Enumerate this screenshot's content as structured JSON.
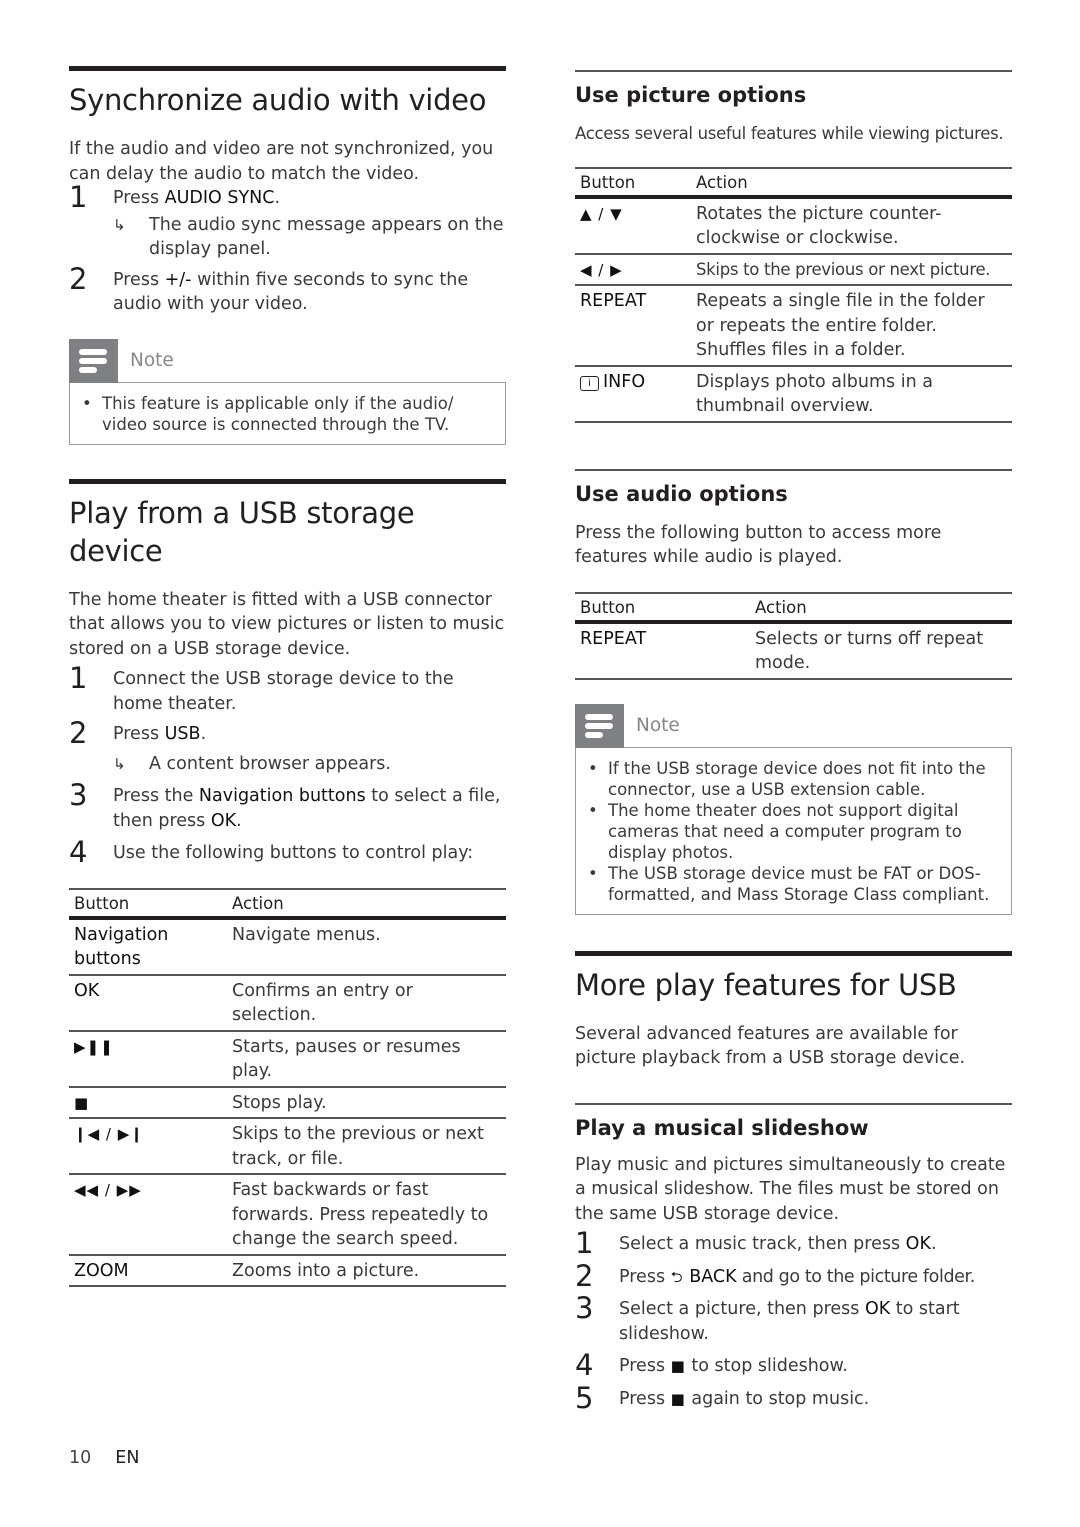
{
  "left": {
    "sync": {
      "title": "Synchronize audio with video",
      "intro": "If the audio and video are not synchronized, you can delay the audio to match the video.",
      "steps": [
        {
          "num": "1",
          "pre": "Press ",
          "kw": "AUDIO SYNC",
          "post": ".",
          "result": "The audio sync message appears on the display panel."
        },
        {
          "num": "2",
          "pre": "Press ",
          "kw": "+/-",
          "post": " within five seconds to sync the audio with your video."
        }
      ],
      "note": {
        "title": "Note",
        "items": [
          "This feature is applicable only if the audio/ video source is connected through the TV."
        ]
      }
    },
    "usb": {
      "title": "Play from a USB storage device",
      "intro": "The home theater is fitted with a USB connector that allows you to view pictures or listen to music stored on a USB storage device.",
      "steps": [
        {
          "num": "1",
          "text": "Connect the USB storage device to the home theater."
        },
        {
          "num": "2",
          "pre": "Press ",
          "kw": "USB",
          "post": ".",
          "result": "A content browser appears."
        },
        {
          "num": "3",
          "pre": "Press the ",
          "kw": "Navigation buttons",
          "mid": " to select a file, then press ",
          "kw2": "OK",
          "post": "."
        },
        {
          "num": "4",
          "text": "Use the following buttons to control play:"
        }
      ],
      "table": {
        "headers": [
          "Button",
          "Action"
        ],
        "rows": [
          {
            "button": "Navigation buttons",
            "icon": "",
            "action": "Navigate menus."
          },
          {
            "button": "OK",
            "icon": "",
            "action": "Confirms an entry or selection."
          },
          {
            "button": "",
            "icon": "▶❚❚",
            "icon_name": "play-pause-icon",
            "action": "Starts, pauses or resumes play."
          },
          {
            "button": "",
            "icon": "■",
            "icon_name": "stop-icon",
            "action": "Stops play."
          },
          {
            "button": "",
            "icon": "❙◀ / ▶❙",
            "icon_name": "skip-prev-next-icon",
            "action": "Skips to the previous or next track, or file."
          },
          {
            "button": "",
            "icon": "◀◀ / ▶▶",
            "icon_name": "rewind-fastforward-icon",
            "action": "Fast backwards or fast forwards. Press repeatedly to change the search speed."
          },
          {
            "button": "ZOOM",
            "icon": "",
            "action": "Zooms into a picture."
          }
        ]
      }
    }
  },
  "right": {
    "picture": {
      "title": "Use picture options",
      "intro": "Access several useful features while viewing pictures.",
      "table": {
        "headers": [
          "Button",
          "Action"
        ],
        "rows": [
          {
            "icon": "▲ / ▼",
            "icon_name": "up-down-arrows-icon",
            "button": "",
            "action": "Rotates the picture counter-clockwise or clockwise."
          },
          {
            "icon": "◀ / ▶",
            "icon_name": "left-right-arrows-icon",
            "button": "",
            "action": "Skips to the previous or next picture."
          },
          {
            "icon": "",
            "button": "REPEAT",
            "action": "Repeats a single file in the folder or repeats the entire folder. Shuffles files in a folder."
          },
          {
            "icon": "i",
            "icon_name": "info-icon",
            "button": "INFO",
            "action": "Displays photo albums in a thumbnail overview."
          }
        ]
      }
    },
    "audio": {
      "title": "Use audio options",
      "intro": "Press the following button to access more features while audio is played.",
      "table": {
        "headers": [
          "Button",
          "Action"
        ],
        "rows": [
          {
            "button": "REPEAT",
            "action": "Selects or turns off repeat mode."
          }
        ]
      },
      "note": {
        "title": "Note",
        "items": [
          "If the USB storage device does not fit into the connector, use a USB extension cable.",
          "The home theater does not support digital cameras that need a computer program to display photos.",
          "The USB storage device must be FAT or DOS-formatted, and Mass Storage Class compliant."
        ]
      }
    },
    "more": {
      "title": "More play features for USB",
      "intro": "Several advanced features are available for picture playback from a USB storage device."
    },
    "slideshow": {
      "title": "Play a musical slideshow",
      "intro": "Play music and pictures simultaneously to create a musical slideshow. The files must be stored on the same USB storage device.",
      "steps": [
        {
          "num": "1",
          "pre": "Select a music track, then press ",
          "kw": "OK",
          "post": "."
        },
        {
          "num": "2",
          "pre": "Press ",
          "icon": "⮌",
          "kw": "BACK",
          "post": " and go to the picture folder."
        },
        {
          "num": "3",
          "pre": "Select a picture, then press ",
          "kw": "OK",
          "post": " to start slideshow."
        },
        {
          "num": "4",
          "pre": "Press ",
          "icon": "■",
          "post": " to stop slideshow."
        },
        {
          "num": "5",
          "pre": "Press ",
          "icon": "■",
          "post": " again to stop music."
        }
      ]
    }
  },
  "footer": {
    "page_number": "10",
    "language": "EN"
  }
}
